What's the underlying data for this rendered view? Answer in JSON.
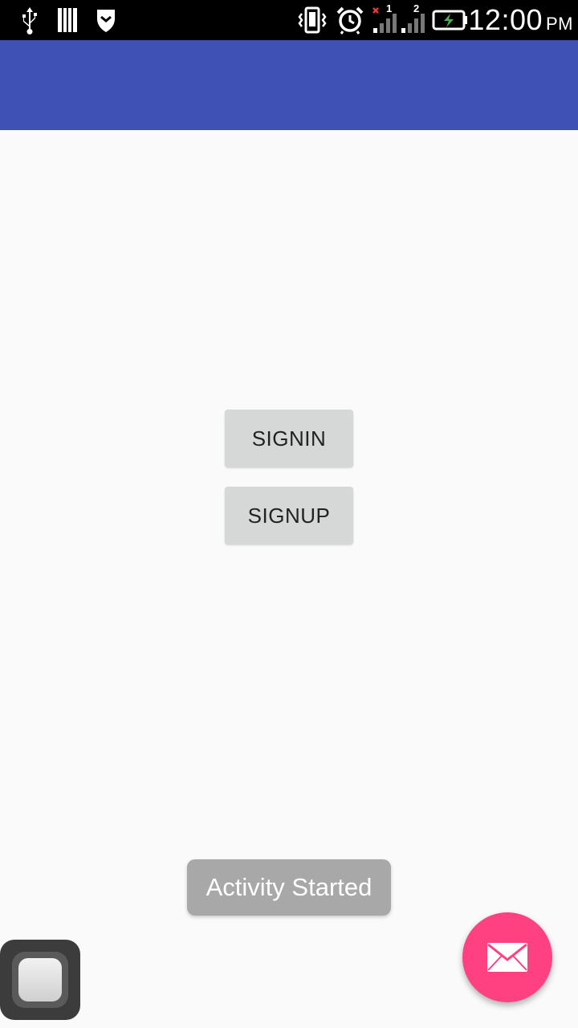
{
  "status_bar": {
    "time": "12:00",
    "ampm": "PM",
    "sim1_label": "1",
    "sim2_label": "2",
    "icons": [
      "usb-icon",
      "sim-card-icon",
      "shield-icon",
      "vibrate-icon",
      "alarm-icon",
      "signal-sim1-icon",
      "signal-sim2-icon",
      "battery-charging-icon"
    ],
    "background_color": "#000000"
  },
  "app_bar": {
    "title": "",
    "color": "#3f51b5"
  },
  "main": {
    "signin_label": "SIGNIN",
    "signup_label": "SIGNUP"
  },
  "toast": {
    "message": "Activity Started"
  },
  "fab": {
    "icon": "mail-icon",
    "color": "#ff4081"
  },
  "assistive_touch": {
    "icon": "assistive-touch-icon"
  }
}
